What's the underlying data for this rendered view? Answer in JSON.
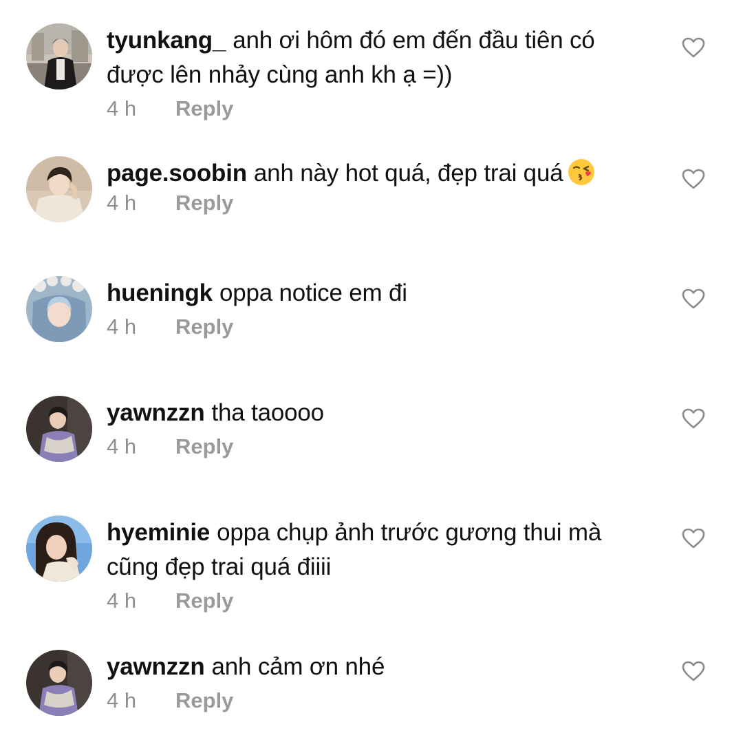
{
  "comments": [
    {
      "username": "tyunkang_",
      "text": "anh ơi hôm đó em đến đầu tiên có được lên nhảy cùng anh kh ạ =))",
      "time": "4 h",
      "reply": "Reply",
      "avatar_icon": "profile-photo-avatar"
    },
    {
      "username": "page.soobin",
      "text": "anh này hot quá, đẹp trai quá",
      "emoji": "face-blowing-kiss-emoji",
      "time": "4 h",
      "reply": "Reply",
      "avatar_icon": "profile-photo-avatar"
    },
    {
      "username": "hueningk",
      "text": "oppa notice em đi",
      "time": "4 h",
      "reply": "Reply",
      "avatar_icon": "profile-photo-avatar"
    },
    {
      "username": "yawnzzn",
      "text": "tha taoooo",
      "time": "4 h",
      "reply": "Reply",
      "avatar_icon": "profile-photo-avatar"
    },
    {
      "username": "hyeminie",
      "text": "oppa chụp ảnh trước gương thui mà cũng đẹp trai quá điiii",
      "time": "4 h",
      "reply": "Reply",
      "avatar_icon": "profile-photo-avatar"
    },
    {
      "username": "yawnzzn",
      "text": "anh cảm ơn nhé",
      "time": "4 h",
      "reply": "Reply",
      "avatar_icon": "profile-photo-avatar"
    }
  ],
  "icons": {
    "like": "heart-outline-icon"
  },
  "colors": {
    "text": "#111111",
    "meta": "#8e8e8e",
    "heart_stroke": "#8a8a8a"
  }
}
